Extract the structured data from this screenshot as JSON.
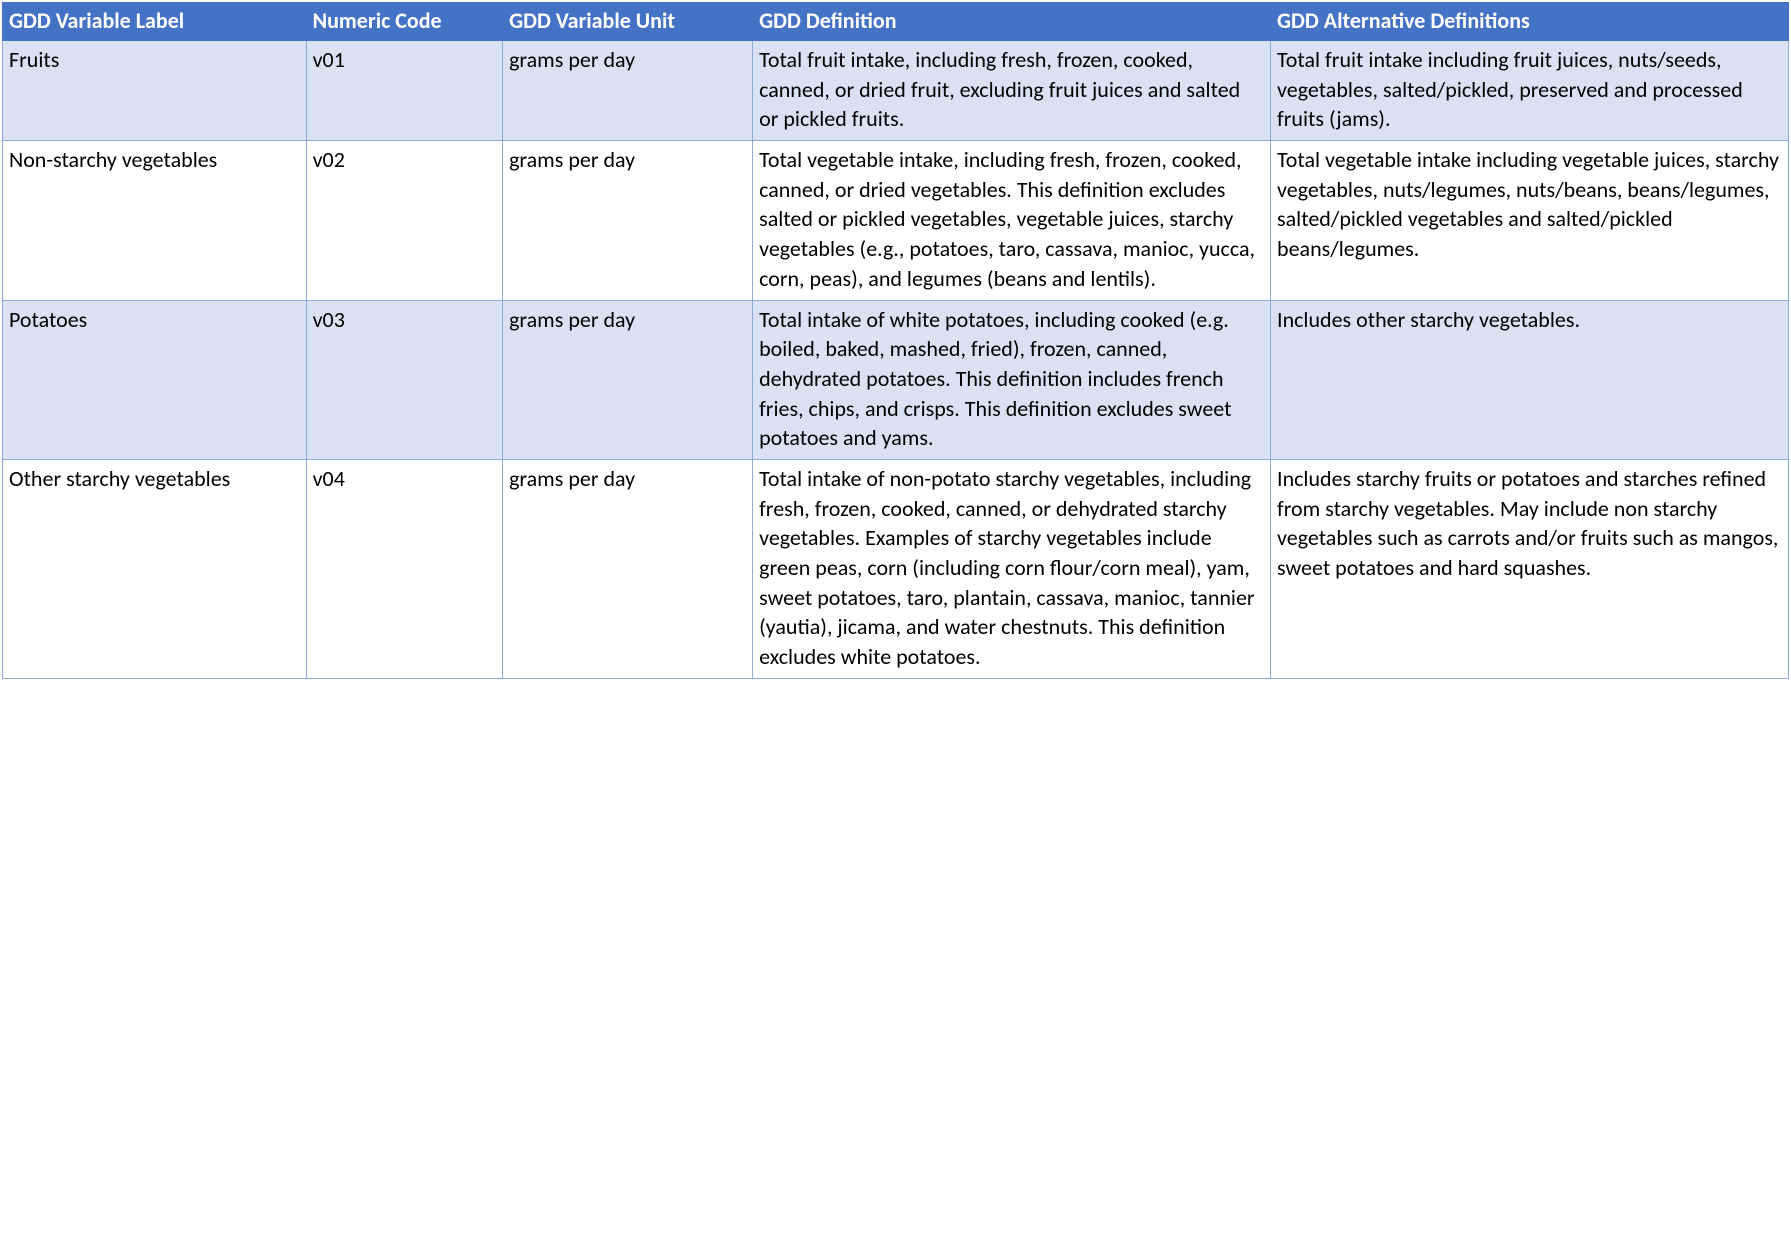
{
  "header": {
    "col_label": "GDD Variable Label",
    "col_code": "Numeric Code",
    "col_unit": "GDD Variable Unit",
    "col_definition": "GDD Definition",
    "col_alternative": "GDD Alternative Definitions"
  },
  "rows": [
    {
      "label": "Fruits",
      "code": "v01",
      "unit": "grams per day",
      "definition": "Total fruit intake, including fresh, frozen, cooked, canned, or dried fruit, excluding fruit juices and salted or pickled fruits.",
      "alternative": "Total fruit intake including fruit juices, nuts/seeds, vegetables, salted/pickled, preserved and processed fruits (jams)."
    },
    {
      "label": "Non-starchy vegetables",
      "code": "v02",
      "unit": "grams per day",
      "definition": "Total vegetable intake, including fresh, frozen, cooked, canned, or dried vegetables. This definition excludes salted or pickled vegetables, vegetable juices, starchy vegetables (e.g., potatoes, taro, cassava, manioc, yucca, corn, peas), and legumes (beans and lentils).",
      "alternative": "Total vegetable intake including vegetable juices, starchy vegetables, nuts/legumes, nuts/beans, beans/legumes, salted/pickled vegetables and salted/pickled beans/legumes."
    },
    {
      "label": "Potatoes",
      "code": "v03",
      "unit": "grams per day",
      "definition": "Total intake of white potatoes, including cooked (e.g. boiled, baked, mashed, fried), frozen, canned, dehydrated potatoes. This definition includes french fries, chips, and crisps. This definition excludes sweet potatoes and yams.",
      "alternative": "Includes other starchy vegetables."
    },
    {
      "label": "Other starchy vegetables",
      "code": "v04",
      "unit": "grams per day",
      "definition": "Total intake of non-potato starchy vegetables, including fresh, frozen, cooked, canned, or dehydrated starchy vegetables. Examples of starchy vegetables include green peas, corn (including corn flour/corn meal), yam, sweet potatoes, taro, plantain, cassava, manioc, tannier (yautia), jicama, and water chestnuts. This definition excludes white potatoes.",
      "alternative": "Includes starchy fruits or potatoes and starches refined from starchy vegetables. May include non starchy vegetables such as carrots and/or fruits such as mangos, sweet potatoes and hard squashes."
    }
  ]
}
